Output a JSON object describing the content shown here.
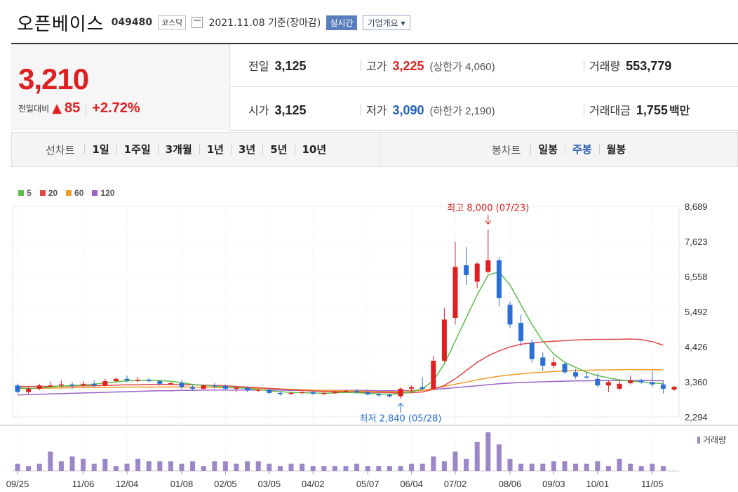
{
  "header": {
    "name": "오픈베이스",
    "code": "049480",
    "market": "코스닥",
    "date": "2021.11.08 기준(장마감)",
    "realtime_label": "실시간",
    "info_label": "기업개요 ▾"
  },
  "quote": {
    "price": "3,210",
    "change_label": "전일대비",
    "change_arrow": "▲",
    "change": "85",
    "change_pct": "+2.72%",
    "prev_close_label": "전일",
    "prev_close": "3,125",
    "high_label": "고가",
    "high": "3,225",
    "upper_limit": "(상한가 4,060)",
    "volume_label": "거래량",
    "volume": "553,779",
    "open_label": "시가",
    "open": "3,125",
    "low_label": "저가",
    "low": "3,090",
    "lower_limit": "(하한가 2,190)",
    "value_label": "거래대금",
    "value": "1,755",
    "value_unit": "백만"
  },
  "tabs": {
    "line_title": "선차트",
    "line_items": [
      "1일",
      "1주일",
      "3개월",
      "1년",
      "3년",
      "5년",
      "10년"
    ],
    "candle_title": "봉차트",
    "candle_items": [
      "일봉",
      "주봉",
      "월봉"
    ],
    "candle_selected": "주봉"
  },
  "colors": {
    "up": "#e02020",
    "down": "#2a6fd6",
    "ma5": "#5cbf4a",
    "ma20": "#e04848",
    "ma60": "#f09a28",
    "ma120": "#9a62c8",
    "volume": "#9b86c8"
  },
  "chart_data": {
    "type": "candlestick",
    "legend": [
      {
        "label": "5",
        "color": "#5cbf4a"
      },
      {
        "label": "20",
        "color": "#e04848"
      },
      {
        "label": "60",
        "color": "#f09a28"
      },
      {
        "label": "120",
        "color": "#9a62c8"
      }
    ],
    "y_ticks": [
      "8,689",
      "7,623",
      "6,558",
      "5,492",
      "4,426",
      "3,360",
      "2,294"
    ],
    "ylim": [
      2294,
      8689
    ],
    "x_labels": [
      "09/25",
      "11/06",
      "12/04",
      "01/08",
      "02/05",
      "03/05",
      "04/02",
      "05/07",
      "06/04",
      "07/02",
      "08/06",
      "09/03",
      "10/01",
      "11/05"
    ],
    "x_label_index": [
      0,
      6,
      10,
      15,
      19,
      23,
      27,
      32,
      36,
      40,
      45,
      49,
      53,
      58
    ],
    "volume_label": "거래량",
    "annotations": {
      "high": {
        "text": "최고 8,000 (07/23)",
        "index": 43,
        "value": 8000
      },
      "low": {
        "text": "최저 2,840 (05/28)",
        "index": 35,
        "value": 2840
      }
    },
    "candles": [
      {
        "o": 3250,
        "h": 3300,
        "c": 3050,
        "l": 3000
      },
      {
        "o": 3050,
        "h": 3200,
        "c": 3150,
        "l": 3000
      },
      {
        "o": 3150,
        "h": 3300,
        "c": 3250,
        "l": 3100
      },
      {
        "o": 3250,
        "h": 3350,
        "c": 3250,
        "l": 3200
      },
      {
        "o": 3250,
        "h": 3400,
        "c": 3280,
        "l": 3180
      },
      {
        "o": 3280,
        "h": 3350,
        "c": 3260,
        "l": 3150
      },
      {
        "o": 3260,
        "h": 3380,
        "c": 3300,
        "l": 3200
      },
      {
        "o": 3300,
        "h": 3400,
        "c": 3250,
        "l": 3200
      },
      {
        "o": 3250,
        "h": 3450,
        "c": 3380,
        "l": 3220
      },
      {
        "o": 3380,
        "h": 3500,
        "c": 3450,
        "l": 3350
      },
      {
        "o": 3450,
        "h": 3550,
        "c": 3400,
        "l": 3350
      },
      {
        "o": 3400,
        "h": 3500,
        "c": 3420,
        "l": 3350
      },
      {
        "o": 3420,
        "h": 3480,
        "c": 3380,
        "l": 3350
      },
      {
        "o": 3380,
        "h": 3400,
        "c": 3300,
        "l": 3250
      },
      {
        "o": 3300,
        "h": 3350,
        "c": 3320,
        "l": 3250
      },
      {
        "o": 3320,
        "h": 3420,
        "c": 3200,
        "l": 3150
      },
      {
        "o": 3200,
        "h": 3260,
        "c": 3150,
        "l": 3100
      },
      {
        "o": 3150,
        "h": 3280,
        "c": 3250,
        "l": 3120
      },
      {
        "o": 3250,
        "h": 3320,
        "c": 3230,
        "l": 3150
      },
      {
        "o": 3230,
        "h": 3280,
        "c": 3150,
        "l": 3100
      },
      {
        "o": 3150,
        "h": 3200,
        "c": 3180,
        "l": 3050
      },
      {
        "o": 3180,
        "h": 3200,
        "c": 3100,
        "l": 3050
      },
      {
        "o": 3100,
        "h": 3150,
        "c": 3120,
        "l": 3050
      },
      {
        "o": 3120,
        "h": 3150,
        "c": 3020,
        "l": 2980
      },
      {
        "o": 3020,
        "h": 3080,
        "c": 2990,
        "l": 2940
      },
      {
        "o": 2990,
        "h": 3060,
        "c": 3020,
        "l": 2970
      },
      {
        "o": 3020,
        "h": 3080,
        "c": 3050,
        "l": 2980
      },
      {
        "o": 3050,
        "h": 3080,
        "c": 3000,
        "l": 2950
      },
      {
        "o": 3000,
        "h": 3060,
        "c": 3020,
        "l": 2960
      },
      {
        "o": 3020,
        "h": 3080,
        "c": 3060,
        "l": 2980
      },
      {
        "o": 3060,
        "h": 3120,
        "c": 3080,
        "l": 3040
      },
      {
        "o": 3080,
        "h": 3140,
        "c": 3040,
        "l": 3000
      },
      {
        "o": 3040,
        "h": 3080,
        "c": 2980,
        "l": 2940
      },
      {
        "o": 2980,
        "h": 3030,
        "c": 2960,
        "l": 2920
      },
      {
        "o": 2960,
        "h": 3000,
        "c": 2920,
        "l": 2880
      },
      {
        "o": 2920,
        "h": 3200,
        "c": 3150,
        "l": 2840
      },
      {
        "o": 3150,
        "h": 3250,
        "c": 3200,
        "l": 3050
      },
      {
        "o": 3200,
        "h": 3500,
        "c": 3150,
        "l": 3120
      },
      {
        "o": 3150,
        "h": 4150,
        "c": 4000,
        "l": 3100
      },
      {
        "o": 4000,
        "h": 5600,
        "c": 5250,
        "l": 3950
      },
      {
        "o": 5300,
        "h": 7600,
        "c": 6850,
        "l": 5100
      },
      {
        "o": 6900,
        "h": 7450,
        "c": 6600,
        "l": 6300
      },
      {
        "o": 6400,
        "h": 7000,
        "c": 6950,
        "l": 6200
      },
      {
        "o": 6700,
        "h": 8000,
        "c": 7050,
        "l": 6650
      },
      {
        "o": 7050,
        "h": 7150,
        "c": 5900,
        "l": 5650
      },
      {
        "o": 5700,
        "h": 5800,
        "c": 5100,
        "l": 5000
      },
      {
        "o": 5150,
        "h": 5400,
        "c": 4600,
        "l": 4450
      },
      {
        "o": 4550,
        "h": 4650,
        "c": 4050,
        "l": 3950
      },
      {
        "o": 4100,
        "h": 4250,
        "c": 3850,
        "l": 3700
      },
      {
        "o": 3850,
        "h": 4100,
        "c": 3950,
        "l": 3780
      },
      {
        "o": 3900,
        "h": 3950,
        "c": 3650,
        "l": 3600
      },
      {
        "o": 3650,
        "h": 3750,
        "c": 3520,
        "l": 3450
      },
      {
        "o": 3520,
        "h": 3650,
        "c": 3500,
        "l": 3450
      },
      {
        "o": 3450,
        "h": 3600,
        "c": 3250,
        "l": 3200
      },
      {
        "o": 3250,
        "h": 3400,
        "c": 3350,
        "l": 3050
      },
      {
        "o": 3150,
        "h": 3400,
        "c": 3300,
        "l": 3100
      },
      {
        "o": 3320,
        "h": 3550,
        "c": 3400,
        "l": 3280
      },
      {
        "o": 3400,
        "h": 3450,
        "c": 3350,
        "l": 3300
      },
      {
        "o": 3350,
        "h": 3700,
        "c": 3280,
        "l": 3200
      },
      {
        "o": 3280,
        "h": 3400,
        "c": 3150,
        "l": 3000
      },
      {
        "o": 3125,
        "h": 3225,
        "c": 3210,
        "l": 3090
      }
    ],
    "volume": [
      3,
      2,
      3,
      8,
      4,
      6,
      5,
      3,
      5,
      2,
      3,
      5,
      4,
      4,
      4,
      3,
      4,
      2,
      4,
      4,
      3,
      4,
      4,
      3,
      2,
      3,
      3,
      2,
      2,
      2,
      2,
      3,
      2,
      2,
      2,
      2,
      3,
      3,
      6,
      4,
      8,
      5,
      12,
      16,
      11,
      5,
      3,
      3,
      3,
      4,
      4,
      3,
      3,
      4,
      2,
      5,
      3,
      2,
      3,
      2
    ],
    "volume_scale": [
      0,
      100
    ],
    "ma5": [
      3180,
      3160,
      3170,
      3200,
      3230,
      3250,
      3260,
      3290,
      3320,
      3360,
      3390,
      3400,
      3410,
      3400,
      3380,
      3330,
      3280,
      3250,
      3230,
      3200,
      3180,
      3160,
      3120,
      3090,
      3060,
      3040,
      3030,
      3020,
      3010,
      3020,
      3040,
      3030,
      3010,
      2990,
      2980,
      3000,
      3050,
      3150,
      3400,
      3900,
      4600,
      5300,
      6000,
      6600,
      6700,
      6300,
      5700,
      5100,
      4600,
      4200,
      3950,
      3800,
      3650,
      3550,
      3480,
      3420,
      3380,
      3360,
      3330,
      3300
    ],
    "ma20": [
      3220,
      3220,
      3220,
      3220,
      3230,
      3230,
      3240,
      3240,
      3250,
      3260,
      3270,
      3270,
      3280,
      3280,
      3280,
      3270,
      3270,
      3260,
      3250,
      3240,
      3220,
      3200,
      3180,
      3160,
      3140,
      3120,
      3100,
      3080,
      3070,
      3060,
      3050,
      3050,
      3040,
      3040,
      3030,
      3020,
      3030,
      3050,
      3130,
      3250,
      3450,
      3700,
      3950,
      4150,
      4300,
      4420,
      4500,
      4540,
      4570,
      4590,
      4610,
      4630,
      4640,
      4650,
      4650,
      4650,
      4660,
      4640,
      4580,
      4470
    ],
    "ma60": [
      3150,
      3160,
      3160,
      3170,
      3170,
      3180,
      3180,
      3190,
      3190,
      3190,
      3200,
      3200,
      3200,
      3200,
      3200,
      3200,
      3200,
      3190,
      3190,
      3180,
      3180,
      3170,
      3160,
      3150,
      3140,
      3130,
      3120,
      3110,
      3100,
      3090,
      3090,
      3080,
      3070,
      3060,
      3060,
      3060,
      3080,
      3100,
      3160,
      3220,
      3290,
      3350,
      3420,
      3480,
      3530,
      3570,
      3600,
      3630,
      3650,
      3670,
      3690,
      3700,
      3710,
      3720,
      3720,
      3730,
      3730,
      3730,
      3730,
      3720
    ],
    "ma120": [
      2960,
      2970,
      2980,
      2990,
      3000,
      3010,
      3020,
      3030,
      3040,
      3050,
      3060,
      3070,
      3080,
      3090,
      3090,
      3100,
      3100,
      3110,
      3110,
      3110,
      3110,
      3110,
      3110,
      3110,
      3110,
      3100,
      3100,
      3100,
      3100,
      3100,
      3100,
      3100,
      3100,
      3090,
      3090,
      3090,
      3100,
      3110,
      3130,
      3150,
      3180,
      3210,
      3240,
      3270,
      3300,
      3320,
      3340,
      3350,
      3360,
      3370,
      3380,
      3390,
      3390,
      3400,
      3400,
      3400,
      3400,
      3400,
      3400,
      3390
    ]
  }
}
